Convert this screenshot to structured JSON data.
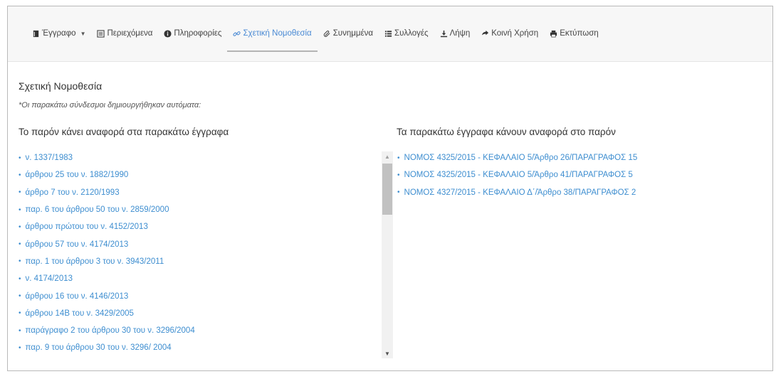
{
  "nav": {
    "tabs": [
      {
        "label": "Έγγραφο",
        "icon": "file-icon"
      },
      {
        "label": "Περιεχόμενα",
        "icon": "list-icon"
      },
      {
        "label": "Πληροφορίες",
        "icon": "info-icon"
      },
      {
        "label": "Σχετική Νομοθεσία",
        "icon": "link-icon"
      },
      {
        "label": "Συνημμένα",
        "icon": "paperclip-icon"
      },
      {
        "label": "Συλλογές",
        "icon": "collection-icon"
      },
      {
        "label": "Λήψη",
        "icon": "download-icon"
      },
      {
        "label": "Κοινή Χρήση",
        "icon": "share-icon"
      },
      {
        "label": "Εκτύπωση",
        "icon": "print-icon"
      }
    ],
    "active_index": 3,
    "active_color": "#4a8ad4"
  },
  "section": {
    "title": "Σχετική Νομοθεσία",
    "note": "*Οι παρακάτω σύνδεσμοι δημιουργήθηκαν αυτόματα:"
  },
  "left_column": {
    "heading": "Το παρόν κάνει αναφορά στα παρακάτω έγγραφα",
    "items": [
      "ν. 1337/1983",
      "άρθρου 25 του ν. 1882/1990",
      "άρθρο 7 του ν. 2120/1993",
      "παρ. 6 του άρθρου 50 του ν. 2859/2000",
      "άρθρου πρώτου του ν. 4152/2013",
      "άρθρου 57 του ν. 4174/2013",
      "παρ. 1 του άρθρου 3 του ν. 3943/2011",
      "ν. 4174/2013",
      "άρθρου 16 του ν. 4146/2013",
      "άρθρου 14Β του ν. 3429/2005",
      "παράγραφο 2 του άρθρου 30 του ν. 3296/2004",
      "παρ. 9 του άρθρου 30 του ν. 3296/ 2004"
    ]
  },
  "right_column": {
    "heading": "Τα παρακάτω έγγραφα κάνουν αναφορά στο παρόν",
    "items": [
      "ΝΟΜΟΣ 4325/2015 - ΚΕΦΑΛΑΙΟ 5/Άρθρο 26/ΠΑΡΑΓΡΑΦΟΣ 15",
      "ΝΟΜΟΣ 4325/2015 - ΚΕΦΑΛΑΙΟ 5/Άρθρο 41/ΠΑΡΑΓΡΑΦΟΣ 5",
      "ΝΟΜΟΣ 4327/2015 - ΚΕΦΑΛΑΙΟ Δ΄/Άρθρο 38/ΠΑΡΑΓΡΑΦΟΣ 2"
    ]
  },
  "colors": {
    "link": "#3e8ed0",
    "nav_bg": "#f7f7f7"
  }
}
